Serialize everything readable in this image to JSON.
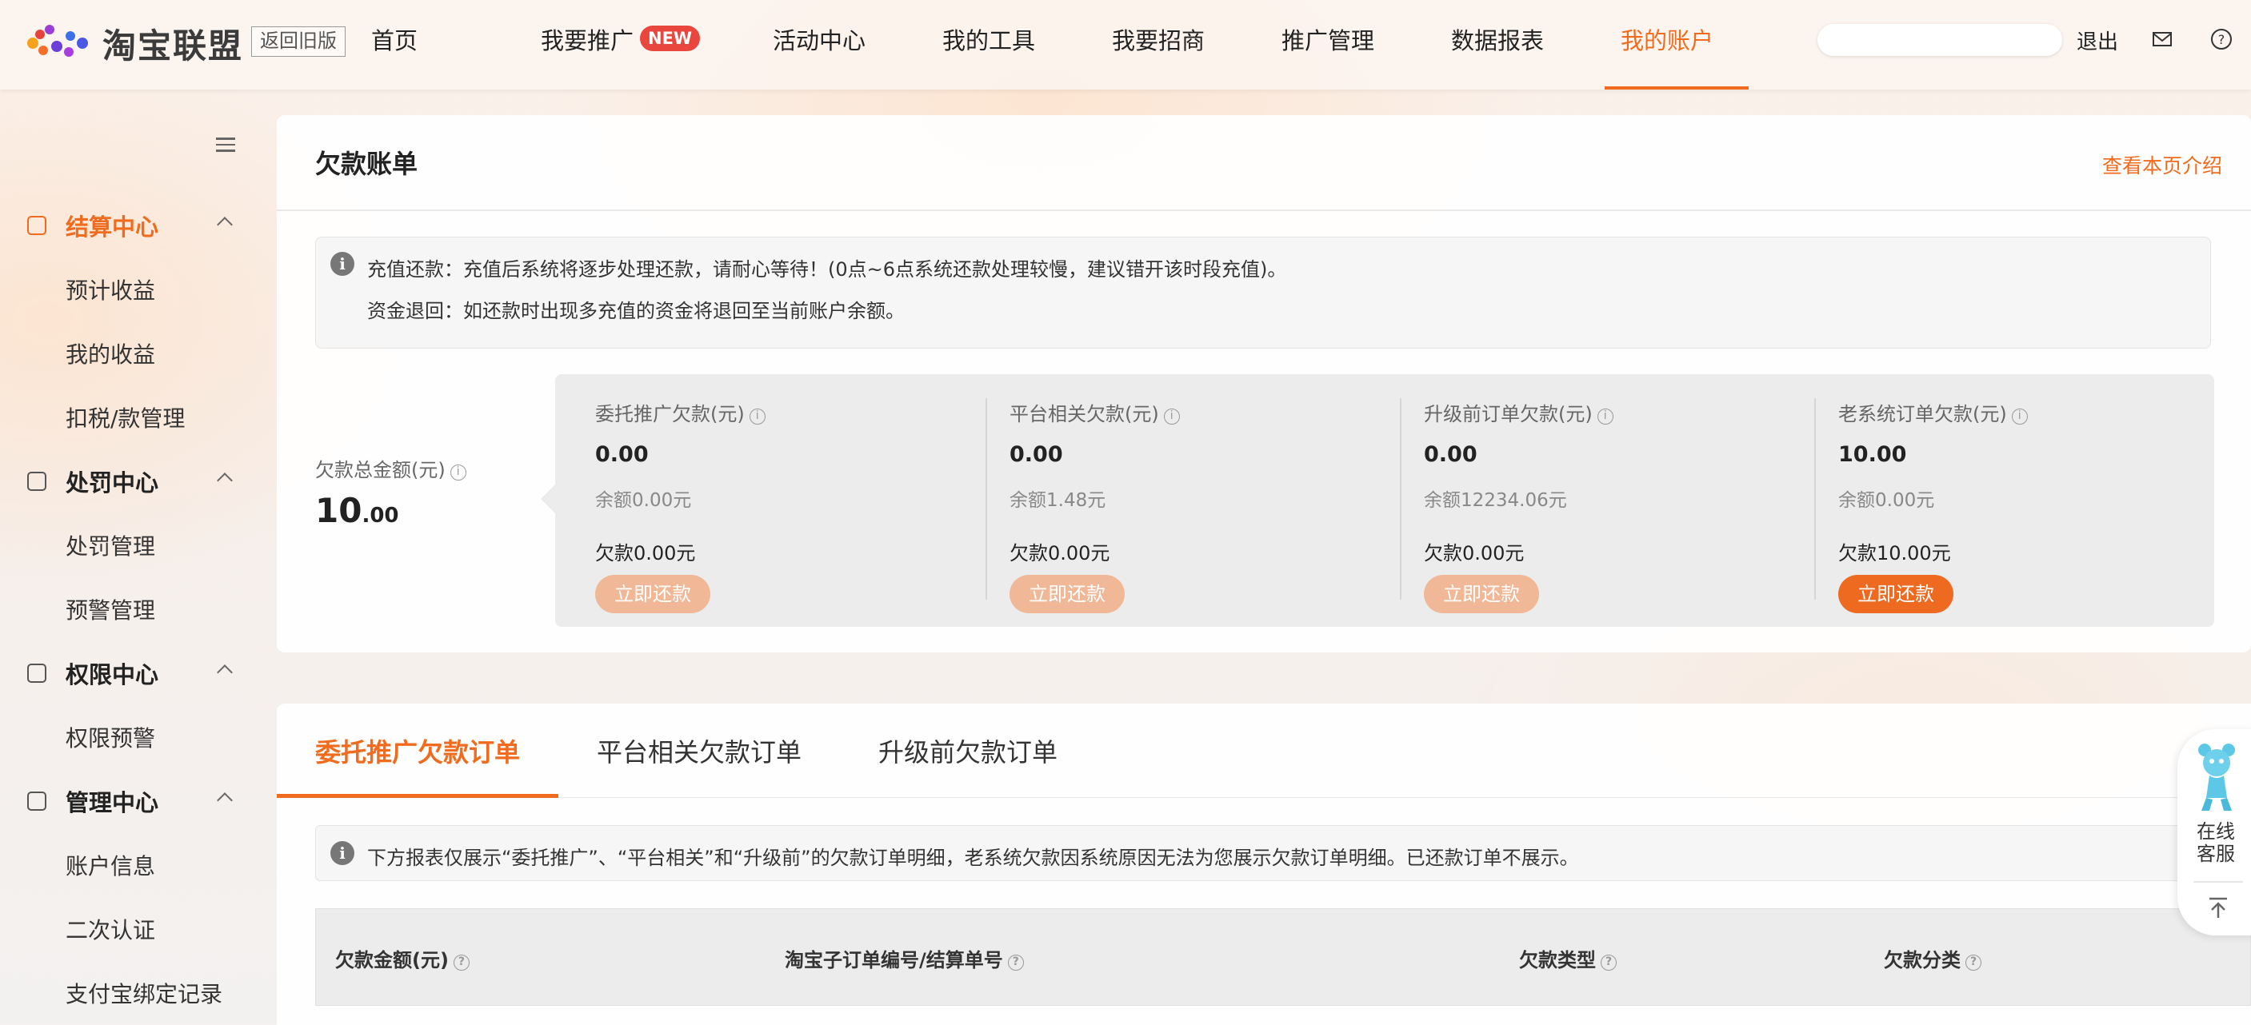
{
  "header": {
    "logo_text": "淘宝联盟",
    "old_version": "返回旧版",
    "nav": [
      {
        "label": "首页",
        "active": false
      },
      {
        "label": "我要推广",
        "badge": "NEW",
        "active": false
      },
      {
        "label": "活动中心",
        "active": false
      },
      {
        "label": "我的工具",
        "active": false
      },
      {
        "label": "我要招商",
        "active": false
      },
      {
        "label": "推广管理",
        "active": false
      },
      {
        "label": "数据报表",
        "active": false
      },
      {
        "label": "我的账户",
        "active": true
      }
    ],
    "logout": "退出",
    "accent_color": "#f06b1e"
  },
  "sidebar": {
    "sections": [
      {
        "label": "结算中心",
        "icon": "wallet-icon",
        "active": true,
        "items": [
          "预计收益",
          "我的收益",
          "扣税/款管理"
        ]
      },
      {
        "label": "处罚中心",
        "icon": "document-icon",
        "active": false,
        "items": [
          "处罚管理",
          "预警管理"
        ]
      },
      {
        "label": "权限中心",
        "icon": "permission-icon",
        "active": false,
        "items": [
          "权限预警"
        ]
      },
      {
        "label": "管理中心",
        "icon": "box-icon",
        "active": false,
        "items": [
          "账户信息",
          "二次认证",
          "支付宝绑定记录"
        ]
      }
    ]
  },
  "bill": {
    "title": "欠款账单",
    "intro_link": "查看本页介绍",
    "notice_lines": [
      "充值还款：充值后系统将逐步处理还款，请耐心等待！(0点~6点系统还款处理较慢，建议错开该时段充值)。",
      "资金退回：如还款时出现多充值的资金将退回至当前账户余额。"
    ],
    "total_label": "欠款总金额(元)",
    "total_int": "10",
    "total_dec": ".00",
    "columns": [
      {
        "title": "委托推广欠款(元)",
        "amount": "0.00",
        "balance": "余额0.00元",
        "owed": "欠款0.00元",
        "button": "立即还款",
        "enabled": false
      },
      {
        "title": "平台相关欠款(元)",
        "amount": "0.00",
        "balance": "余额1.48元",
        "owed": "欠款0.00元",
        "button": "立即还款",
        "enabled": false
      },
      {
        "title": "升级前订单欠款(元)",
        "amount": "0.00",
        "balance": "余额12234.06元",
        "owed": "欠款0.00元",
        "button": "立即还款",
        "enabled": false
      },
      {
        "title": "老系统订单欠款(元)",
        "amount": "10.00",
        "balance": "余额0.00元",
        "owed": "欠款10.00元",
        "button": "立即还款",
        "enabled": true
      }
    ]
  },
  "orders": {
    "tabs": [
      {
        "label": "委托推广欠款订单",
        "active": true
      },
      {
        "label": "平台相关欠款订单",
        "active": false
      },
      {
        "label": "升级前欠款订单",
        "active": false
      }
    ],
    "notice": "下方报表仅展示“委托推广”、“平台相关”和“升级前”的欠款订单明细，老系统欠款因系统原因无法为您展示欠款订单明细。已还款订单不展示。",
    "columns": [
      "欠款金额(元)",
      "淘宝子订单编号/结算单号",
      "欠款类型",
      "欠款分类"
    ]
  },
  "float_service": {
    "label_line1": "在线",
    "label_line2": "客服"
  }
}
